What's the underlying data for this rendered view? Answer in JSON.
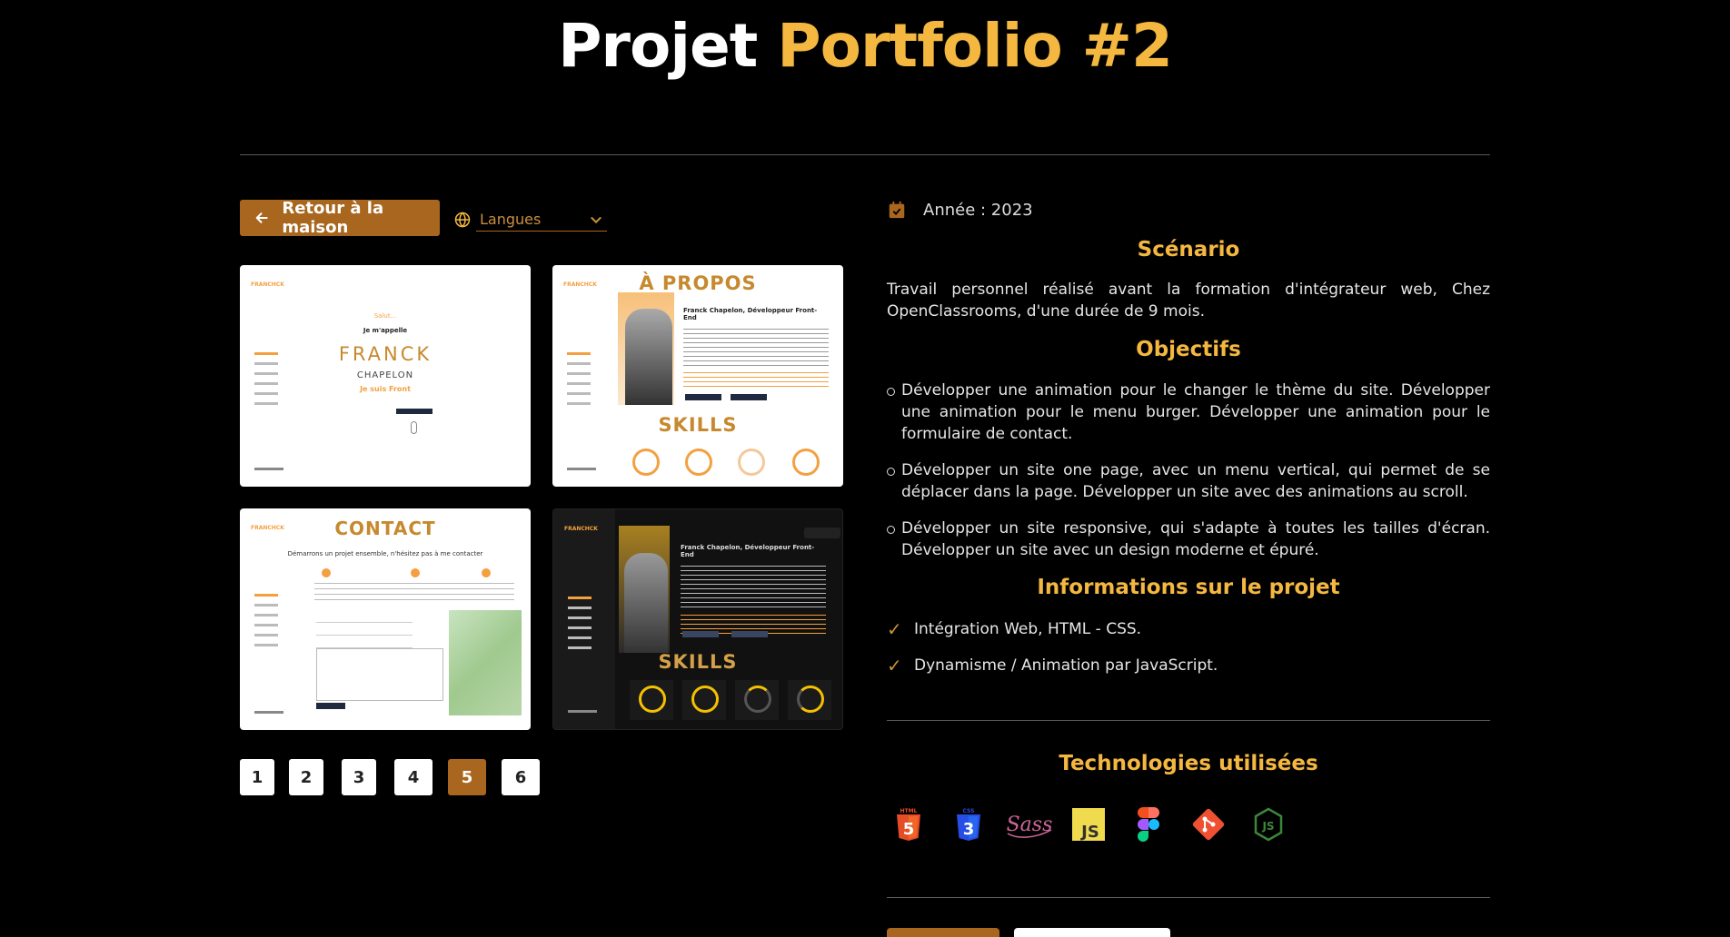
{
  "title": {
    "part1": "Projet",
    "part2": "Portfolio #2"
  },
  "toolbar": {
    "back_label": "Retour à la maison",
    "lang_placeholder": "Langues"
  },
  "gallery": {
    "shot1": {
      "line1": "Salut...",
      "line2": "Je m'appelle",
      "line3": "FRANCK",
      "line4": "CHAPELON",
      "line5": "Je suis Front"
    },
    "shot2": {
      "heading": "À PROPOS",
      "subheading": "Franck Chapelon, Développeur Front-End",
      "skills": "SKILLS"
    },
    "shot3": {
      "heading": "CONTACT",
      "subheading": "Démarrons un projet ensemble, n'hésitez pas à me contacter"
    },
    "shot4": {
      "subheading": "Franck Chapelon, Développeur Front-End",
      "skills": "SKILLS"
    }
  },
  "pagination": {
    "pages": [
      "1",
      "2",
      "3",
      "4",
      "5",
      "6"
    ],
    "active": "5"
  },
  "info": {
    "year": "Année : 2023",
    "scenario_title": "Scénario",
    "scenario_text": "Travail personnel réalisé avant la formation d'intégrateur web, Chez OpenClassrooms, d'une durée de 9 mois.",
    "objectives_title": "Objectifs",
    "objectives": [
      "Développer une animation pour le changer le thème du site. Développer une animation pour le menu burger. Développer une animation pour le formulaire de contact.",
      "Développer un site one page, avec un menu vertical, qui permet de se déplacer dans la page. Développer un site avec des animations au scroll.",
      "Développer un site responsive, qui s'adapte à toutes les tailles d'écran. Développer un site avec un design moderne et épuré."
    ],
    "project_info_title": "Informations sur le projet",
    "project_info": [
      "Intégration Web, HTML - CSS.",
      "Dynamisme / Animation par JavaScript."
    ],
    "tech_title": "Technologies utilisées",
    "tech_icons": [
      "html5-icon",
      "css3-icon",
      "sass-icon",
      "javascript-icon",
      "figma-icon",
      "git-icon",
      "nodejs-icon"
    ]
  },
  "colors": {
    "accent": "#f4b740",
    "button": "#a8661e",
    "background": "#000000"
  }
}
